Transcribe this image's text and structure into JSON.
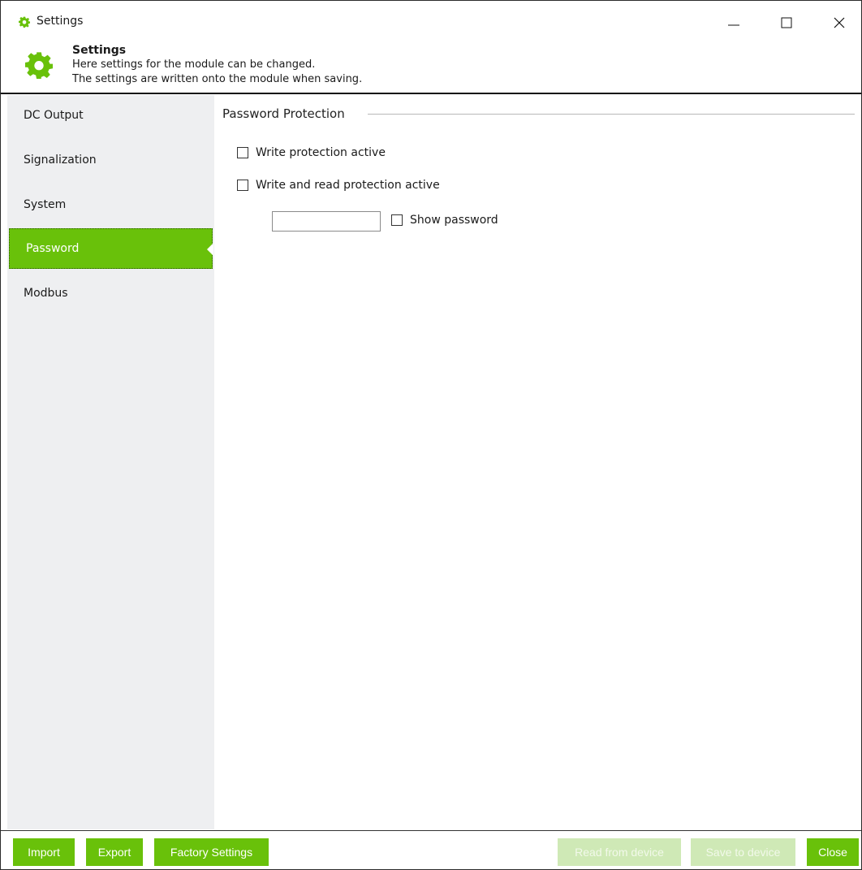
{
  "window": {
    "title": "Settings",
    "controls": {
      "minimize": "minimize",
      "maximize": "maximize",
      "close": "close"
    }
  },
  "header": {
    "title": "Settings",
    "line1": "Here settings for the module can be changed.",
    "line2": "The settings are written onto the module when saving."
  },
  "sidebar": {
    "items": [
      {
        "label": "DC Output",
        "active": false
      },
      {
        "label": "Signalization",
        "active": false
      },
      {
        "label": "System",
        "active": false
      },
      {
        "label": "Password",
        "active": true
      },
      {
        "label": "Modbus",
        "active": false
      }
    ]
  },
  "content": {
    "group_title": "Password Protection",
    "write_protection_label": "Write protection active",
    "write_protection_checked": false,
    "rw_protection_label": "Write and read protection active",
    "rw_protection_checked": false,
    "password_value": "",
    "show_password_label": "Show password",
    "show_password_checked": false
  },
  "footer": {
    "import_label": "Import",
    "export_label": "Export",
    "factory_label": "Factory Settings",
    "read_label": "Read from device",
    "read_enabled": false,
    "save_label": "Save to device",
    "save_enabled": false,
    "close_label": "Close"
  },
  "colors": {
    "accent": "#69c10a",
    "accent_disabled": "#cfe9b6",
    "sidebar_bg": "#eeeff1"
  },
  "icons": {
    "title": "gear-icon",
    "header": "gear-icon"
  }
}
